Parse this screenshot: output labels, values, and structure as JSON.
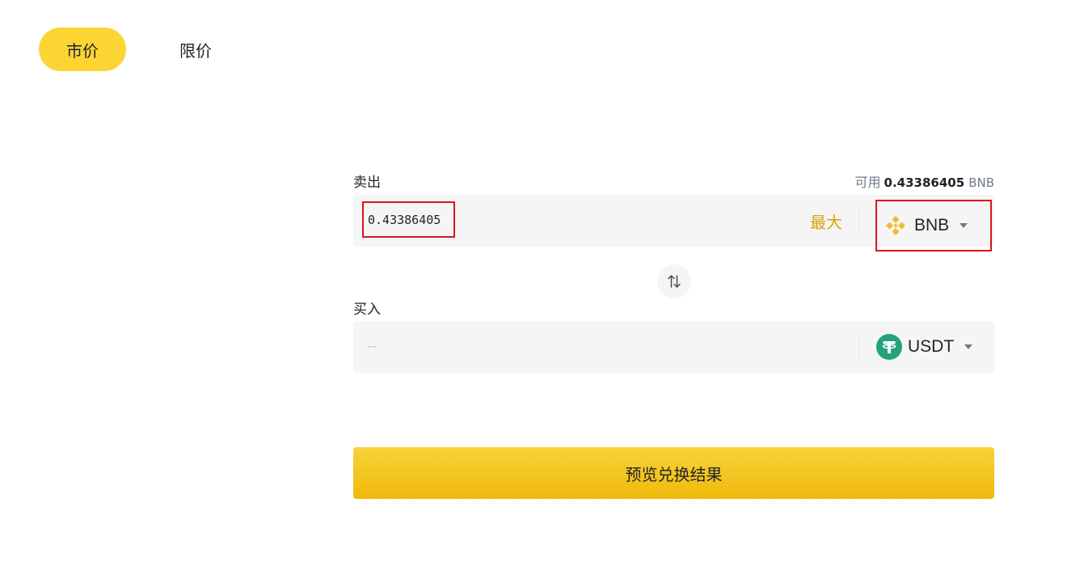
{
  "tabs": {
    "market": "市价",
    "limit": "限价"
  },
  "sell": {
    "label": "卖出",
    "available_label": "可用",
    "available_amount": "0.43386405",
    "available_currency": "BNB",
    "amount_value": "0.43386405",
    "max_label": "最大",
    "coin": "BNB",
    "coin_icon": "bnb-icon"
  },
  "buy": {
    "label": "买入",
    "placeholder": "--",
    "coin": "USDT",
    "coin_icon": "usdt-icon"
  },
  "swap_icon": "swap-arrows-icon",
  "preview_button": "预览兑换结果",
  "colors": {
    "accent": "#fcd535",
    "max_text": "#d6a20e",
    "highlight_border": "#d9141e",
    "bnb": "#f3ba2f",
    "usdt": "#26a17b"
  }
}
